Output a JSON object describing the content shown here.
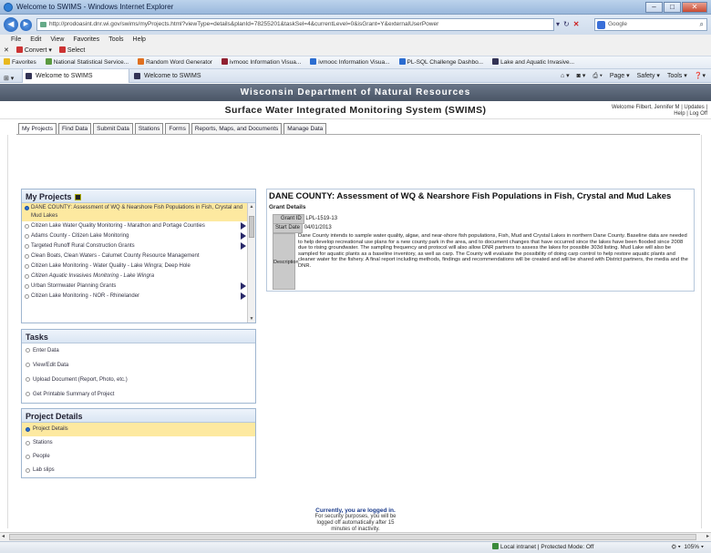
{
  "browser": {
    "title": "Welcome to SWIMS - Windows Internet Explorer",
    "url": "http://prodoasint.dnr.wi.gov/swims/myProjects.html?viewType=details&planId=78255201&taskSel=4&currentLevel=0&isGrant=Y&externalUserPower",
    "search_placeholder": "Google",
    "menu": [
      "File",
      "Edit",
      "View",
      "Favorites",
      "Tools",
      "Help"
    ],
    "cmd": [
      "Convert",
      "Select"
    ],
    "favorites_label": "Favorites",
    "favorites": [
      "National Statistical Service...",
      "Random Word Generator",
      "ivmooc Information Visua...",
      "ivmooc Information Visua...",
      "PL-SQL Challenge Dashbo...",
      "Lake and Aquatic Invasive..."
    ],
    "tabs": [
      "Welcome to SWIMS",
      "Welcome to SWIMS"
    ],
    "tab_tools": [
      "Page ▾",
      "Safety ▾",
      "Tools ▾"
    ],
    "status_zone": "Local intranet | Protected Mode: Off",
    "zoom": "105%"
  },
  "site": {
    "org": "Wisconsin Department of Natural Resources",
    "system": "Surface Water Integrated Monitoring System (SWIMS)",
    "welcome": "Welcome Filbert, Jennifer M | Updates |",
    "help_logoff": "Help | Log Off",
    "nav": [
      "My Projects",
      "Find Data",
      "Submit Data",
      "Stations",
      "Forms",
      "Reports, Maps, and Documents",
      "Manage Data"
    ]
  },
  "projects": {
    "title": "My Projects",
    "items": [
      "DANE COUNTY: Assessment of WQ & Nearshore Fish Populations in Fish, Crystal and Mud Lakes",
      "Citizen Lake Water Quality Monitoring - Marathon and Portage Counties",
      "Adams County - Citizen Lake Monitoring",
      "Targeted Runoff Rural Construction Grants",
      "Clean Boats, Clean Waters - Calumet County Resource Management",
      "Citizen Lake Monitoring - Water Quality - Lake Wingra; Deep Hole",
      "Citizen Aquatic Invasives Monitoring - Lake Wingra",
      "Urban Stormwater Planning Grants",
      "Citizen Lake Monitoring - NOR - Rhinelander"
    ]
  },
  "tasks": {
    "title": "Tasks",
    "items": [
      "Enter Data",
      "View/Edit Data",
      "Upload Document (Report, Photo, etc.)",
      "Get Printable Summary of Project"
    ]
  },
  "project_details": {
    "title": "Project Details",
    "items": [
      "Project Details",
      "Stations",
      "People",
      "Lab slips"
    ]
  },
  "detail": {
    "title": "DANE COUNTY: Assessment of WQ & Nearshore Fish Populations in Fish, Crystal and Mud Lakes",
    "grant_details": "Grant Details",
    "grant_id_label": "Grant ID",
    "grant_id": "LPL-1519-13",
    "start_date_label": "Start Date",
    "start_date": "04/01/2013",
    "description_label": "Description",
    "description": "Dane County intends to sample water quality, algae, and near-shore fish populations, Fish, Mud and Crystal Lakes in northern Dane County. Baseline data are needed to help develop recreational use plans for a new county park in the area, and to document changes that have occurred since the lakes have been flooded since 2008 due to rising groundwater. The sampling frequency and protocol will also allow DNR partners to assess the lakes for possible 303d listing. Mud Lake will also be sampled for aquatic plants as a baseline inventory, as well as carp. The County will evaluate the possibility of doing carp control to help restore aquatic plants and cleaner water for the fishery. A final report including methods, findings and recommendations will be created and will be shared with District partners, the media and the DNR."
  },
  "footer": {
    "logged_in": "Currently, you are logged in.",
    "note": "For security purposes, you will be logged off automatically after 15 minutes of inactivity."
  }
}
